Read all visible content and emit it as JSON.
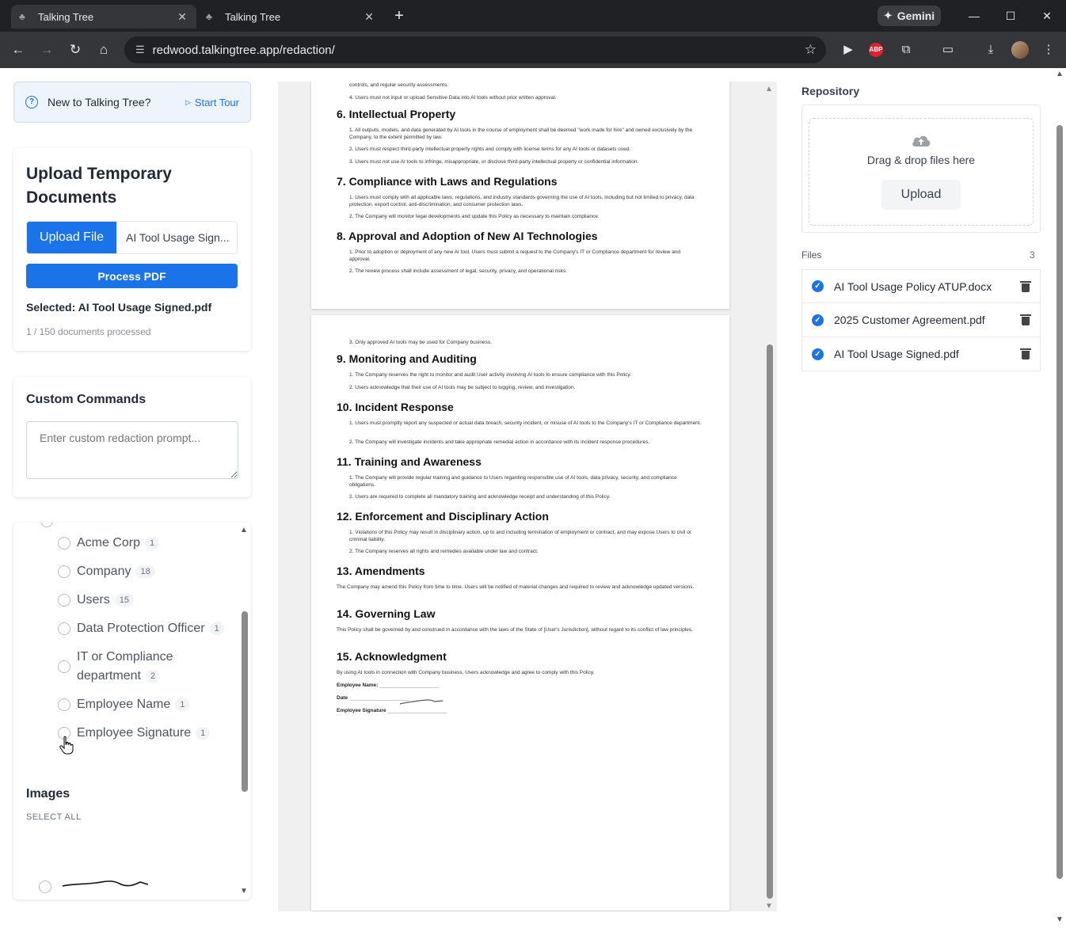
{
  "browser": {
    "tabs": [
      {
        "title": "Talking Tree",
        "active": true
      },
      {
        "title": "Talking Tree",
        "active": false
      }
    ],
    "gemini_label": "Gemini",
    "url": "redwood.talkingtree.app/redaction/",
    "extension_abp": "ABP"
  },
  "tour": {
    "text": "New to Talking Tree?",
    "start_label": "Start Tour"
  },
  "upload": {
    "title": "Upload Temporary Documents",
    "upload_button": "Upload File",
    "file_name": "AI Tool Usage Sign...",
    "process_button": "Process PDF",
    "selected": "Selected: AI Tool Usage Signed.pdf",
    "doc_count": "1 / 150 documents processed"
  },
  "commands": {
    "title": "Custom Commands",
    "placeholder": "Enter custom redaction prompt..."
  },
  "entities": [
    {
      "label": "Acme Corp",
      "count": "1"
    },
    {
      "label": "Company",
      "count": "18"
    },
    {
      "label": "Users",
      "count": "15"
    },
    {
      "label": "Data Protection Officer",
      "count": "1"
    },
    {
      "label_line1": "IT or Compliance",
      "label_line2": "department",
      "count": "2"
    },
    {
      "label": "Employee Name",
      "count": "1"
    },
    {
      "label": "Employee Signature",
      "count": "1"
    }
  ],
  "images": {
    "title": "Images",
    "select_all": "SELECT ALL"
  },
  "document": {
    "page1": {
      "top_lines": [
        "controls, and regular security assessments.",
        "4.  Users must not input or upload Sensitive Data into AI tools without prior written approval."
      ],
      "sections": [
        {
          "heading": "6. Intellectual Property",
          "items": [
            "1.  All outputs, models, and data generated by AI tools in the course of employment shall be deemed \"work made for hire\" and owned exclusively by the Company, to the extent permitted by law.",
            "2.  Users must respect third-party intellectual property rights and comply with license terms for any AI tools or datasets used.",
            "3.  Users must not use AI tools to infringe, misappropriate, or disclose third-party intellectual property or confidential information."
          ]
        },
        {
          "heading": "7. Compliance with Laws and Regulations",
          "items": [
            "1.  Users must comply with all applicable laws, regulations, and industry standards governing the use of AI tools, including but not limited to privacy, data protection, export control, anti-discrimination, and consumer protection laws.",
            "2.  The Company will monitor legal developments and update this Policy as necessary to maintain compliance."
          ]
        },
        {
          "heading": "8. Approval and Adoption of New AI Technologies",
          "items": [
            "1.  Prior to adoption or deployment of any new AI tool, Users must submit a request to the Company's IT or Compliance department for review and approval.",
            "2.  The review process shall include assessment of legal, security, privacy, and operational risks."
          ]
        }
      ]
    },
    "page2": {
      "top_line": "3.  Only approved AI tools may be used for Company business.",
      "sections": [
        {
          "heading": "9. Monitoring and Auditing",
          "items": [
            "1.  The Company reserves the right to monitor and audit User activity involving AI tools to ensure compliance with this Policy.",
            "2.  Users acknowledge that their use of AI tools may be subject to logging, review, and investigation."
          ]
        },
        {
          "heading": "10. Incident Response",
          "items": [
            "1.  Users must promptly report any suspected or actual data breach, security incident, or misuse of AI tools to the Company's IT or Compliance department.",
            "2.  The Company will investigate incidents and take appropriate remedial action in accordance with its incident response procedures."
          ]
        },
        {
          "heading": "11. Training and Awareness",
          "items": [
            "1.  The Company will provide regular training and guidance to Users regarding responsible use of AI tools, data privacy, security, and compliance obligations.",
            "2.  Users are required to complete all mandatory training and acknowledge receipt and understanding of this Policy."
          ]
        },
        {
          "heading": "12. Enforcement and Disciplinary Action",
          "items": [
            "1.  Violations of this Policy may result in disciplinary action, up to and including termination of employment or contract, and may expose Users to civil or criminal liability.",
            "2.  The Company reserves all rights and remedies available under law and contract."
          ]
        },
        {
          "heading": "13. Amendments",
          "paragraph": "The Company may amend this Policy from time to time. Users will be notified of material changes and required to review and acknowledge updated versions."
        },
        {
          "heading": "14. Governing Law",
          "paragraph": "This Policy shall be governed by and construed in accordance with the laws of the State of [User's Jurisdiction], without regard to its conflict of law principles."
        },
        {
          "heading": "15. Acknowledgment",
          "paragraph": "By using AI tools in connection with Company business, Users acknowledge and agree to comply with this Policy."
        }
      ],
      "fields": {
        "name_label": "Employee Name:",
        "date_label": "Date",
        "signature_label": "Employee Signature",
        "blank": "________________________"
      }
    }
  },
  "repository": {
    "title": "Repository",
    "drop_text": "Drag & drop files here",
    "upload_button": "Upload",
    "files_title": "Files",
    "files_count": "3",
    "files": [
      {
        "name": "AI Tool Usage Policy ATUP.docx"
      },
      {
        "name": "2025 Customer Agreement.pdf"
      },
      {
        "name": "AI Tool Usage Signed.pdf"
      }
    ]
  },
  "colors": {
    "accent": "#1a73e8",
    "chrome_dark": "#202124",
    "chrome_tab": "#35363a"
  }
}
